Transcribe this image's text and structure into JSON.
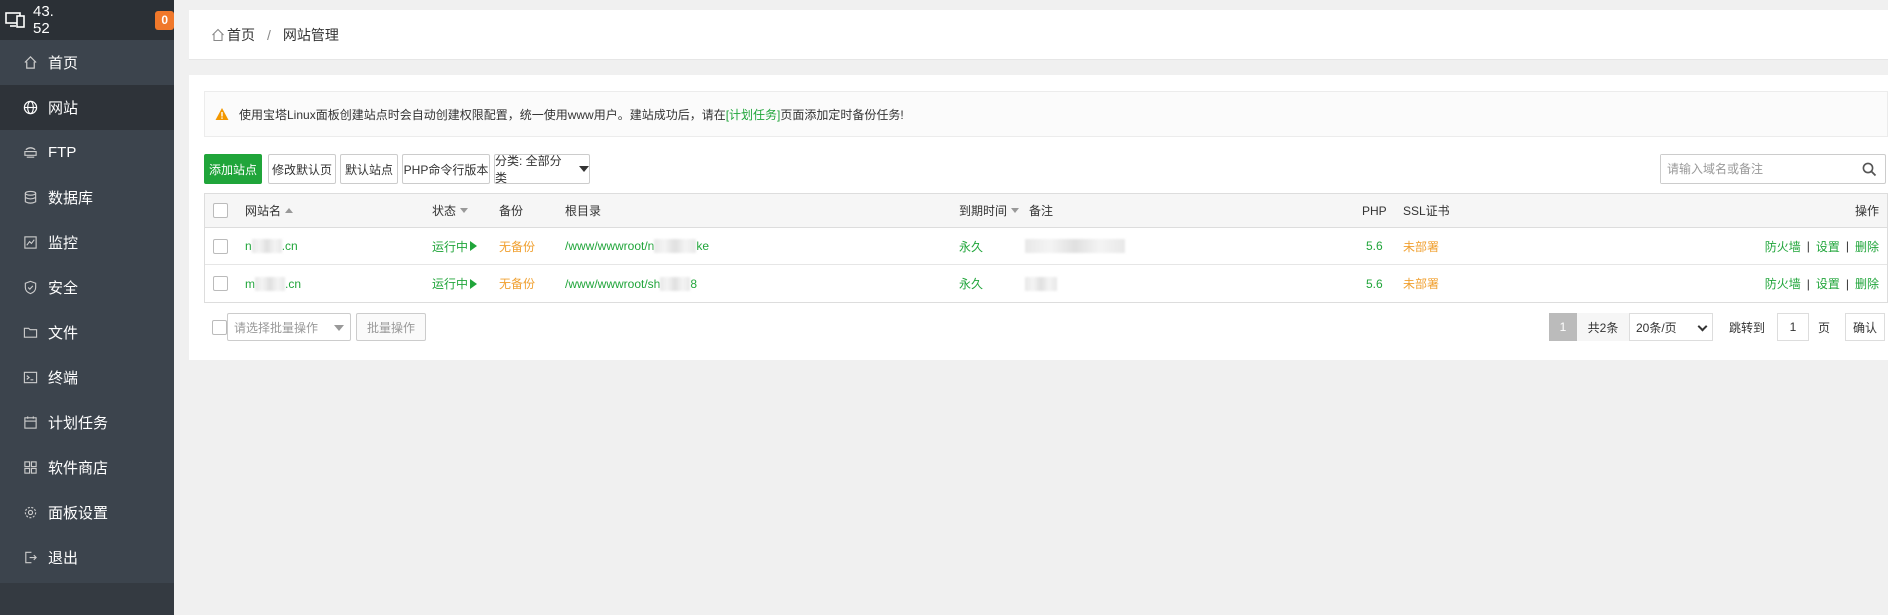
{
  "sidebar": {
    "server_ip": "43.     52",
    "badge_count": "0",
    "items": [
      {
        "label": "首页",
        "icon": "home-icon"
      },
      {
        "label": "网站",
        "icon": "globe-icon"
      },
      {
        "label": "FTP",
        "icon": "ftp-icon"
      },
      {
        "label": "数据库",
        "icon": "database-icon"
      },
      {
        "label": "监控",
        "icon": "monitor-icon"
      },
      {
        "label": "安全",
        "icon": "shield-icon"
      },
      {
        "label": "文件",
        "icon": "folder-icon"
      },
      {
        "label": "终端",
        "icon": "terminal-icon"
      },
      {
        "label": "计划任务",
        "icon": "calendar-icon"
      },
      {
        "label": "软件商店",
        "icon": "apps-icon"
      },
      {
        "label": "面板设置",
        "icon": "gear-icon"
      },
      {
        "label": "退出",
        "icon": "logout-icon"
      }
    ],
    "active_index": 1
  },
  "breadcrumb": {
    "home": "首页",
    "separator": "/",
    "current": "网站管理"
  },
  "notice": {
    "text_before": "使用宝塔Linux面板创建站点时会自动创建权限配置，统一使用www用户。建站成功后，请在",
    "link": "[计划任务]",
    "text_after": "页面添加定时备份任务!"
  },
  "toolbar": {
    "add_site": "添加站点",
    "modify_default_page": "修改默认页",
    "default_site": "默认站点",
    "php_cli_version": "PHP命令行版本",
    "category": "分类: 全部分类",
    "search_placeholder": "请输入域名或备注"
  },
  "table": {
    "headers": {
      "name": "网站名",
      "status": "状态",
      "backup": "备份",
      "root": "根目录",
      "expire": "到期时间",
      "note": "备注",
      "php": "PHP",
      "ssl": "SSL证书",
      "ops": "操作"
    },
    "rows": [
      {
        "name_a": "n",
        "name_b": ".cn",
        "status": "运行中",
        "backup": "无备份",
        "root_a": "/www/wwwroot/n",
        "root_b": "ke",
        "expire": "永久",
        "php": "5.6",
        "ssl": "未部署",
        "op_firewall": "防火墙",
        "op_settings": "设置",
        "op_delete": "删除"
      },
      {
        "name_a": "m",
        "name_b": ".cn",
        "status": "运行中",
        "backup": "无备份",
        "root_a": "/www/wwwroot/sh",
        "root_b": "8",
        "expire": "永久",
        "php": "5.6",
        "ssl": "未部署",
        "op_firewall": "防火墙",
        "op_settings": "设置",
        "op_delete": "删除"
      }
    ]
  },
  "footer": {
    "batch_placeholder": "请选择批量操作",
    "batch_button": "批量操作",
    "current_page": "1",
    "total": "共2条",
    "page_size": "20条/页",
    "jump_label": "跳转到",
    "jump_value": "1",
    "page_unit": "页",
    "confirm": "确认"
  },
  "colors": {
    "accent": "#20a53a",
    "warning": "#f0a030",
    "sidebar": "#3c444d",
    "badge": "#f0782b"
  }
}
